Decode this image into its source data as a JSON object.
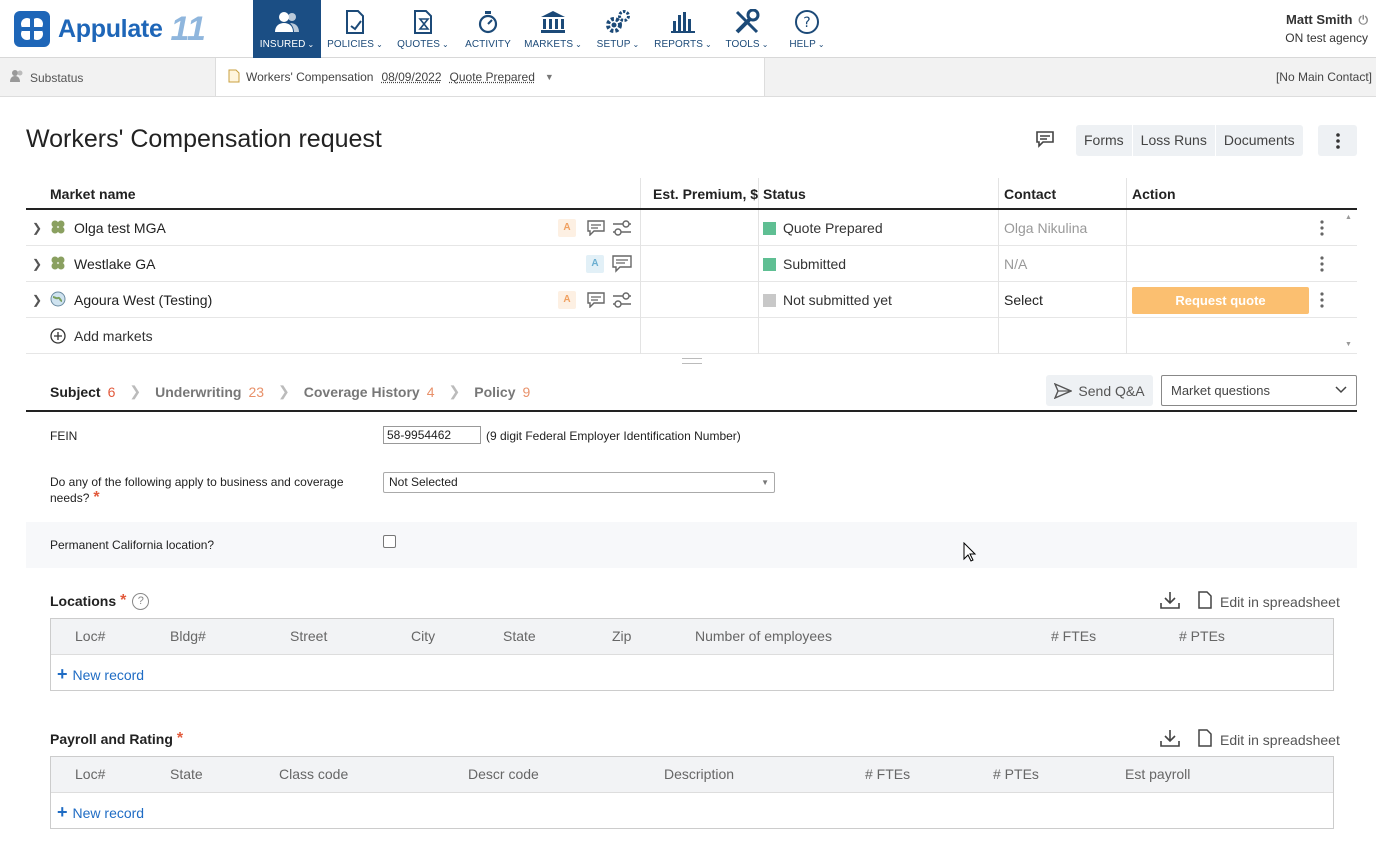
{
  "app": {
    "name": "Appulate",
    "version_mark": "11"
  },
  "nav": [
    {
      "label": "INSURED",
      "icon": "users-icon",
      "active": true
    },
    {
      "label": "POLICIES",
      "icon": "policy-doc-icon"
    },
    {
      "label": "QUOTES",
      "icon": "quote-hourglass-icon"
    },
    {
      "label": "ACTIVITY",
      "icon": "stopwatch-icon"
    },
    {
      "label": "MARKETS",
      "icon": "bank-icon"
    },
    {
      "label": "SETUP",
      "icon": "gears-icon"
    },
    {
      "label": "REPORTS",
      "icon": "bar-chart-icon"
    },
    {
      "label": "TOOLS",
      "icon": "tools-icon"
    },
    {
      "label": "HELP",
      "icon": "help-circle-icon"
    }
  ],
  "user": {
    "name": "Matt Smith",
    "agency": "ON test agency"
  },
  "subbar": {
    "substatus": "Substatus",
    "policy_type": "Workers' Compensation",
    "date": "08/09/2022",
    "status": "Quote Prepared",
    "main_contact": "[No Main Contact]"
  },
  "page": {
    "title": "Workers' Compensation request",
    "buttons": {
      "forms": "Forms",
      "loss_runs": "Loss Runs",
      "documents": "Documents"
    }
  },
  "markets": {
    "headers": {
      "name": "Market name",
      "premium": "Est. Premium, $",
      "status": "Status",
      "contact": "Contact",
      "action": "Action"
    },
    "rows": [
      {
        "name": "Olga test MGA",
        "badge": "A",
        "status": "Quote Prepared",
        "status_color": "#5fbf93",
        "contact": "Olga Nikulina",
        "action": ""
      },
      {
        "name": "Westlake GA",
        "badge": "A",
        "status": "Submitted",
        "status_color": "#5fbf93",
        "contact": "N/A",
        "action": ""
      },
      {
        "name": "Agoura West (Testing)",
        "badge": "A",
        "status": "Not submitted yet",
        "status_color": "#c8c8c8",
        "contact": "Select",
        "action": "Request quote"
      }
    ],
    "add_label": "Add markets"
  },
  "tabs": [
    {
      "label": "Subject",
      "count": "6"
    },
    {
      "label": "Underwriting",
      "count": "23"
    },
    {
      "label": "Coverage History",
      "count": "4"
    },
    {
      "label": "Policy",
      "count": "9"
    }
  ],
  "qa": {
    "send_label": "Send Q&A",
    "market_questions": "Market questions"
  },
  "form": {
    "fein_label": "FEIN",
    "fein_value": "58-9954462",
    "fein_hint": "(9 digit Federal Employer Identification Number)",
    "apply_label_1": "Do any of the following apply to business and coverage",
    "apply_label_2": "needs?",
    "apply_value": "Not Selected",
    "california_label": "Permanent California location?"
  },
  "locations": {
    "title": "Locations",
    "edit_label": "Edit in spreadsheet",
    "columns": [
      "Loc#",
      "Bldg#",
      "Street",
      "City",
      "State",
      "Zip",
      "Number of employees",
      "# FTEs",
      "# PTEs"
    ],
    "new_record": "New record"
  },
  "payroll": {
    "title": "Payroll and Rating",
    "edit_label": "Edit in spreadsheet",
    "columns": [
      "Loc#",
      "State",
      "Class code",
      "Descr code",
      "Description",
      "# FTEs",
      "# PTEs",
      "Est payroll"
    ],
    "new_record": "New record"
  }
}
